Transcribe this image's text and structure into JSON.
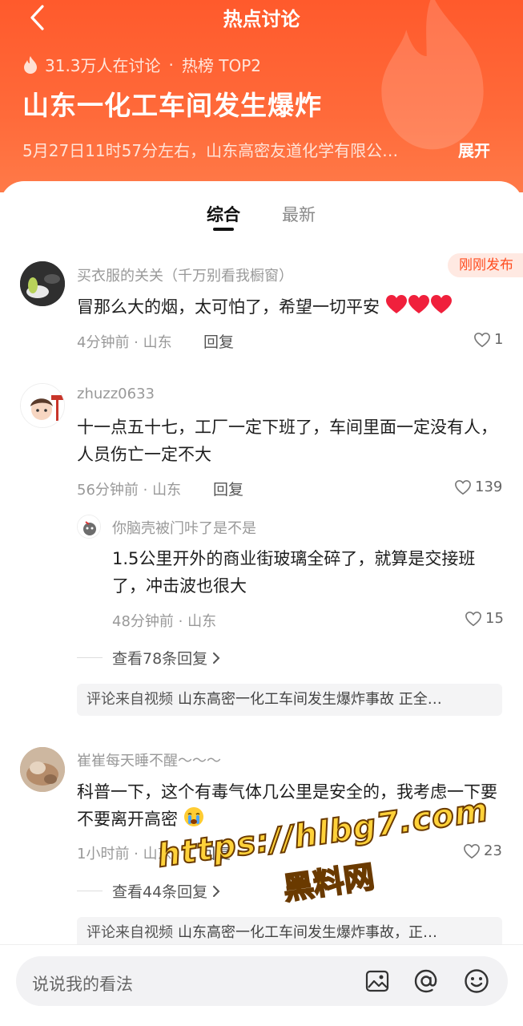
{
  "nav": {
    "title": "热点讨论"
  },
  "topic": {
    "participants": "31.3万人在讨论",
    "rank": "热榜 TOP2",
    "separator": "·",
    "title": "山东一化工车间发生爆炸",
    "description": "5月27日11时57分左右，山东高密友道化学有限公…",
    "expand_label": "展开"
  },
  "tabs": [
    {
      "label": "综合",
      "active": true
    },
    {
      "label": "最新",
      "active": false
    }
  ],
  "badge_new": "刚刚发布",
  "comments": [
    {
      "username": "买衣服的关关（千万别看我橱窗）",
      "content": "冒那么大的烟，太可怕了，希望一切平安",
      "time": "4分钟前 · 山东",
      "reply_label": "回复",
      "likes": "1"
    },
    {
      "username": "zhuzz0633",
      "content": "十一点五十七，工厂一定下班了，车间里面一定没有人，人员伤亡一定不大",
      "time": "56分钟前 · 山东",
      "reply_label": "回复",
      "likes": "139",
      "reply": {
        "username": "你脑壳被门咔了是不是",
        "content": "1.5公里开外的商业街玻璃全碎了，就算是交接班了，冲击波也很大",
        "time": "48分钟前 · 山东",
        "likes": "15"
      },
      "view_replies": "查看78条回复",
      "source_label": "评论来自视频",
      "source_text": "山东高密一化工车间发生爆炸事故 正全…"
    },
    {
      "username": "崔崔每天睡不醒～～～",
      "content": "科普一下，这个有毒气体几公里是安全的，我考虑一下要不要离开高密",
      "time": "1小时前 · 山东",
      "reply_label": "回复",
      "likes": "23",
      "view_replies": "查看44条回复",
      "source_label": "评论来自视频",
      "source_text": "山东高密一化工车间发生爆炸事故，正…"
    }
  ],
  "watermark": {
    "line1": "https://hlbg7.com",
    "line2": "黑料网"
  },
  "composer": {
    "placeholder": "说说我的看法"
  },
  "colors": {
    "accent": "#ff5a2c",
    "badge_bg": "#ffe9e2",
    "badge_text": "#ff4d20"
  },
  "icons": [
    "back-icon",
    "fire-icon",
    "heart-outline-icon",
    "chevron-right-icon",
    "image-icon",
    "at-icon",
    "emoji-icon"
  ]
}
